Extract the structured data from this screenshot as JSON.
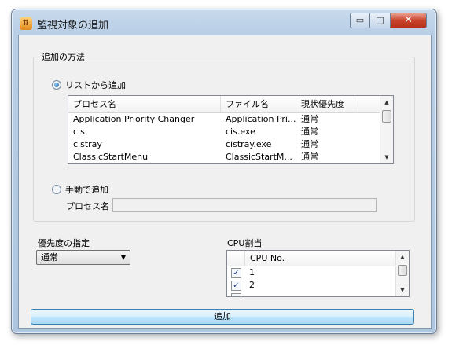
{
  "window": {
    "title": "監視対象の追加",
    "app_icon": "app-icon",
    "minimize_glyph": "▭",
    "maximize_glyph": "□",
    "close_glyph": "✕"
  },
  "method_group": {
    "legend": "追加の方法",
    "radio_list_label": "リストから追加",
    "radio_list_selected": true,
    "radio_manual_label": "手動で追加",
    "radio_manual_selected": false,
    "process_list": {
      "columns": [
        "プロセス名",
        "ファイル名",
        "現状優先度"
      ],
      "rows": [
        [
          "Application Priority Changer",
          "Application Pri...",
          "通常"
        ],
        [
          "cis",
          "cis.exe",
          "通常"
        ],
        [
          "cistray",
          "cistray.exe",
          "通常"
        ],
        [
          "ClassicStartMenu",
          "ClassicStartM...",
          "通常"
        ]
      ]
    },
    "process_name_label": "プロセス名",
    "process_name_value": ""
  },
  "priority": {
    "label": "優先度の指定",
    "selected": "通常"
  },
  "cpu": {
    "label": "CPU割当",
    "column": "CPU No.",
    "rows": [
      {
        "checked": true,
        "number": "1"
      },
      {
        "checked": true,
        "number": "2"
      }
    ]
  },
  "add_button_label": "追加",
  "scroll_glyphs": {
    "up": "▲",
    "down": "▼"
  },
  "colors": {
    "window_frame": "#b9cfe6",
    "close_button": "#c8432a",
    "client_bg": "#f0f0f0",
    "button_border": "#3c7fb1"
  }
}
